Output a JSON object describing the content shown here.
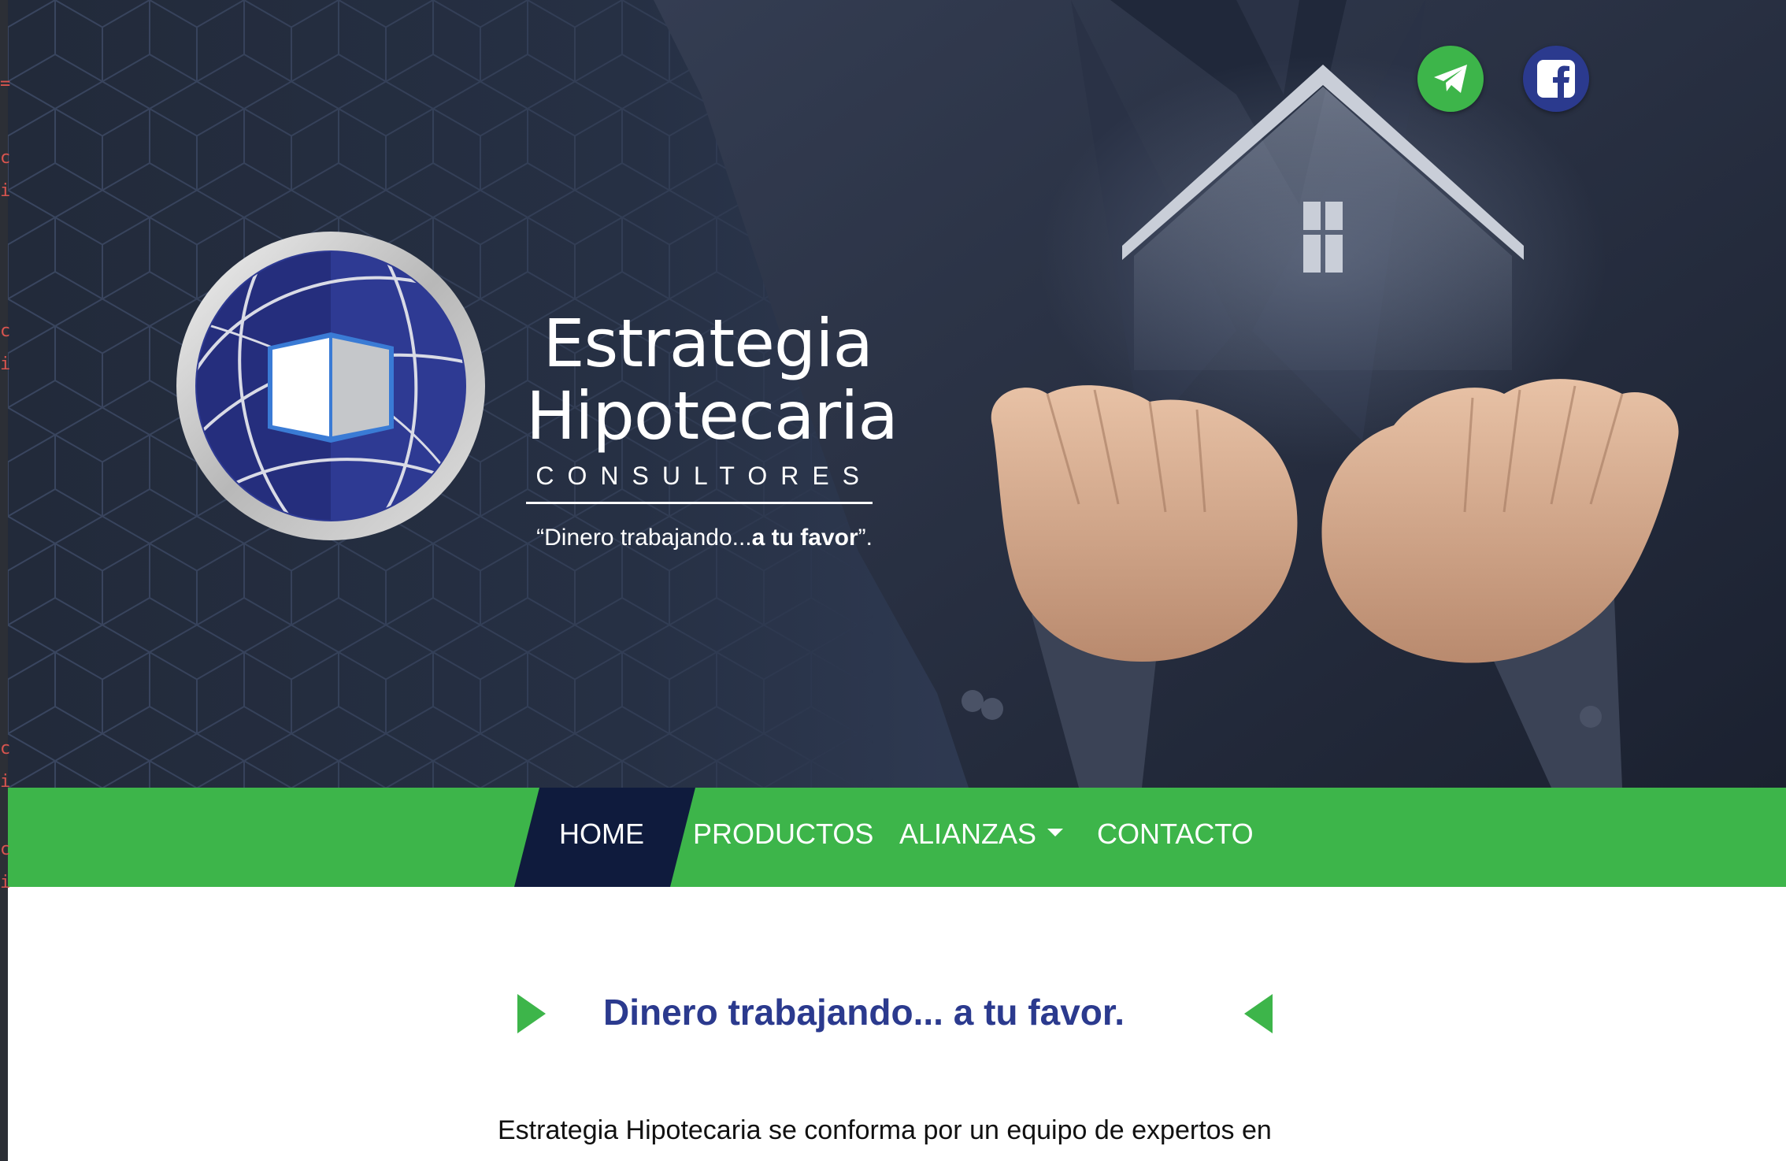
{
  "brand": {
    "name_line1": "Estrategia",
    "name_line2": "Hipotecaria",
    "subtitle": "CONSULTORES",
    "slogan_open": "“Dinero trabajando...",
    "slogan_bold": "a tu favor",
    "slogan_close": "”."
  },
  "social": {
    "telegram": "telegram-icon",
    "facebook": "facebook-icon"
  },
  "nav": {
    "items": [
      {
        "label": "HOME",
        "active": true
      },
      {
        "label": "PRODUCTOS"
      },
      {
        "label": "ALIANZAS",
        "has_dropdown": true
      },
      {
        "label": "CONTACTO"
      }
    ]
  },
  "content": {
    "heading": "Dinero trabajando... a tu favor.",
    "intro": "Estrategia Hipotecaria se conforma por un equipo de expertos en"
  },
  "editor_gutter": [
    "=",
    "c",
    "i",
    "c",
    "i",
    "c",
    "i",
    "c",
    "i"
  ],
  "colors": {
    "green": "#3db54a",
    "navy": "#0f1b3d",
    "brand_blue": "#2b3a8e"
  }
}
